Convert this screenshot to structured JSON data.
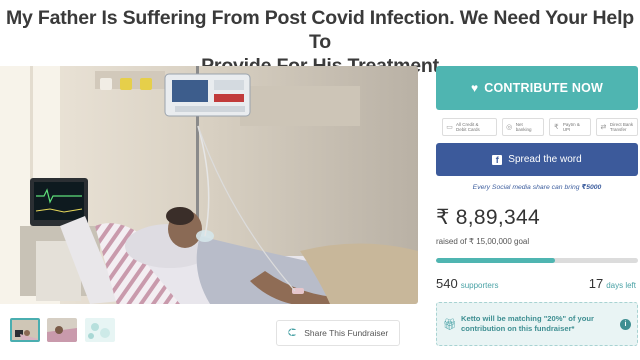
{
  "campaign": {
    "title_line1": "My Father Is Suffering From Post Covid Infection. We Need Your Help To",
    "title_line2": "Provide For His Treatment"
  },
  "media": {
    "hero_alt": "hospital-patient-photo",
    "thumbnails": [
      "thumb-1",
      "thumb-2",
      "thumb-3"
    ],
    "share_button_label": "Share This Fundraiser",
    "share_icon": "share-icon"
  },
  "donate": {
    "contribute_label": "CONTRIBUTE NOW",
    "contribute_icon": "heart-icon",
    "payment_methods": [
      {
        "icon": "card-icon",
        "line1": "All Credit &",
        "line2": "Debit Cards"
      },
      {
        "icon": "bank-icon",
        "line1": "Net",
        "line2": "banking"
      },
      {
        "icon": "upi-icon",
        "line1": "Paytm &",
        "line2": "UPI"
      },
      {
        "icon": "transfer-icon",
        "line1": "Direct Bank",
        "line2": "Transfer"
      }
    ],
    "spread_label": "Spread the word",
    "spread_icon": "facebook-icon",
    "share_note_prefix": "Every Social media share can bring ",
    "share_note_amount": "₹5000"
  },
  "stats": {
    "raised_amount": "₹ 8,89,344",
    "goal_prefix": "raised of ",
    "goal_amount": "₹ 15,00,000",
    "goal_suffix": " goal",
    "progress_fraction": 0.59,
    "supporters_count": "540",
    "supporters_label": "supporters",
    "days_count": "17",
    "days_label": "days left"
  },
  "matching": {
    "text": "Ketto will be matching \"20%\" of your contribution on this fundraiser*",
    "icon": "gift-icon",
    "info_icon": "info-icon"
  },
  "colors": {
    "teal": "#4fb5b1",
    "facebook_blue": "#3c5a9b",
    "note_blue": "#3d5e9e"
  }
}
